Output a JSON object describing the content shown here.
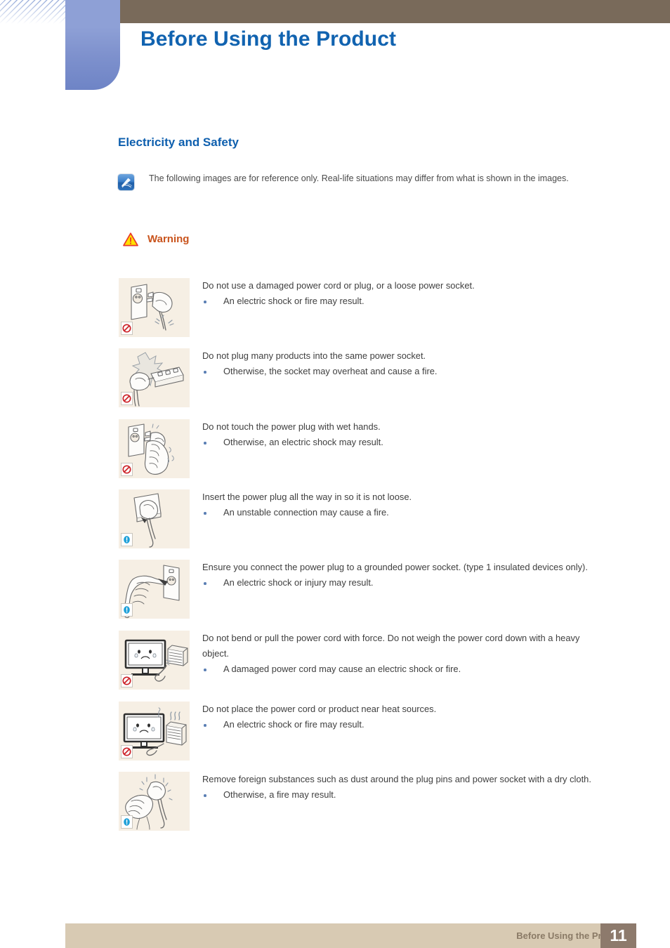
{
  "header": {
    "title": "Before Using the Product"
  },
  "section": {
    "title": "Electricity and Safety",
    "note": {
      "icon": "note-pen-icon",
      "text": "The following images are for reference only. Real-life situations may differ from what is shown in the images."
    },
    "warning": {
      "icon": "warning-triangle-icon",
      "label": "Warning"
    }
  },
  "items": [
    {
      "illustration": "damaged-plug-and-socket-illustration",
      "badge": "prohibition-icon",
      "lead": "Do not use a damaged power cord or plug, or a loose power socket.",
      "bullets": [
        "An electric shock or fire may result."
      ]
    },
    {
      "illustration": "overloaded-power-strip-illustration",
      "badge": "prohibition-icon",
      "lead": "Do not plug many products into the same power socket.",
      "bullets": [
        "Otherwise, the socket may overheat and cause a fire."
      ]
    },
    {
      "illustration": "wet-hand-touching-plug-illustration",
      "badge": "prohibition-icon",
      "lead": "Do not touch the power plug with wet hands.",
      "bullets": [
        "Otherwise, an electric shock may result."
      ]
    },
    {
      "illustration": "plug-fully-inserted-illustration",
      "badge": "mandatory-icon",
      "lead": "Insert the power plug all the way in so it is not loose.",
      "bullets": [
        "An unstable connection may cause a fire."
      ]
    },
    {
      "illustration": "grounded-socket-connection-illustration",
      "badge": "mandatory-icon",
      "lead": "Ensure you connect the power plug to a grounded power socket. (type 1 insulated devices only).",
      "bullets": [
        "An electric shock or injury may result."
      ]
    },
    {
      "illustration": "monitor-with-weighted-cord-illustration",
      "badge": "prohibition-icon",
      "lead": "Do not bend or pull the power cord with force. Do not weigh the power cord down with a heavy object.",
      "bullets": [
        "A damaged power cord may cause an electric shock or fire."
      ]
    },
    {
      "illustration": "monitor-near-heater-illustration",
      "badge": "prohibition-icon",
      "lead": "Do not place the power cord or product near heat sources.",
      "bullets": [
        "An electric shock or fire may result."
      ]
    },
    {
      "illustration": "cleaning-plug-pins-illustration",
      "badge": "mandatory-icon",
      "lead": "Remove foreign substances such as dust around the plug pins and power socket with a dry cloth.",
      "bullets": [
        "Otherwise, a fire may result."
      ]
    }
  ],
  "footer": {
    "label": "Before Using the Product",
    "page": "11"
  },
  "colors": {
    "header_bar": "#796a5a",
    "header_tab": "#8291d2",
    "title_blue": "#1163b0",
    "section_blue": "#0e5fae",
    "warning_orange": "#c9541d",
    "thumb_bg": "#f6efe4",
    "footer_bar": "#d8cab3",
    "footer_page_block": "#8d7a6c",
    "bullet_blue": "#5b7fb4",
    "prohibition_red": "#cc2127",
    "mandatory_blue": "#1b9fd8"
  }
}
